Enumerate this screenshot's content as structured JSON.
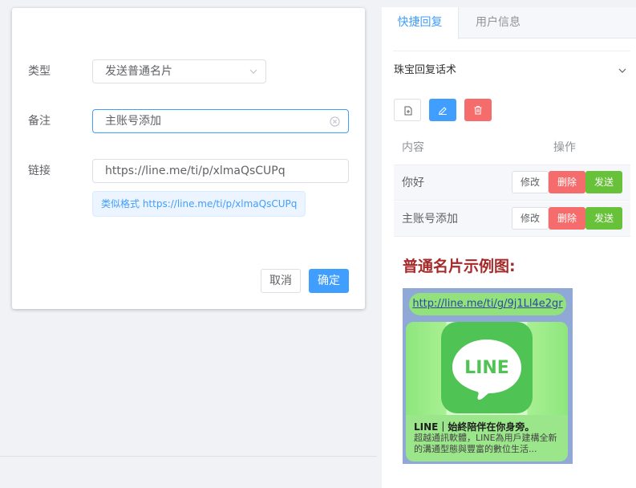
{
  "form": {
    "type_label": "类型",
    "type_value": "发送普通名片",
    "note_label": "备注",
    "note_value": "主账号添加",
    "link_label": "链接",
    "link_value": "https://line.me/ti/p/xlmaQsCUPq",
    "hint": "类似格式 https://line.me/ti/p/xlmaQsCUPq",
    "cancel": "取消",
    "confirm": "确定"
  },
  "panel": {
    "tabs": [
      {
        "label": "快捷回复",
        "active": true
      },
      {
        "label": "用户信息",
        "active": false
      }
    ],
    "group_select": "珠宝回复话术",
    "table": {
      "headers": [
        "内容",
        "操作"
      ],
      "rows": [
        {
          "content": "你好",
          "modify": "修改",
          "delete": "删除",
          "send": "发送"
        },
        {
          "content": "主账号添加",
          "modify": "修改",
          "delete": "删除",
          "send": "发送"
        }
      ]
    },
    "example_title": "普通名片示例图:",
    "example": {
      "url": "http://line.me/ti/g/9j1Ll4e2gr",
      "logo_text": "LINE",
      "card_title": "LINE｜始終陪伴在你身旁。",
      "card_desc": "超越通訊軟體，LINE為用戶建構全新的溝通型態與豐富的數位生活..."
    }
  },
  "colors": {
    "primary": "#409eff",
    "danger": "#f56c6c",
    "success": "#67c23a",
    "title_red": "#a52a2a",
    "line_green": "#4fc354"
  }
}
